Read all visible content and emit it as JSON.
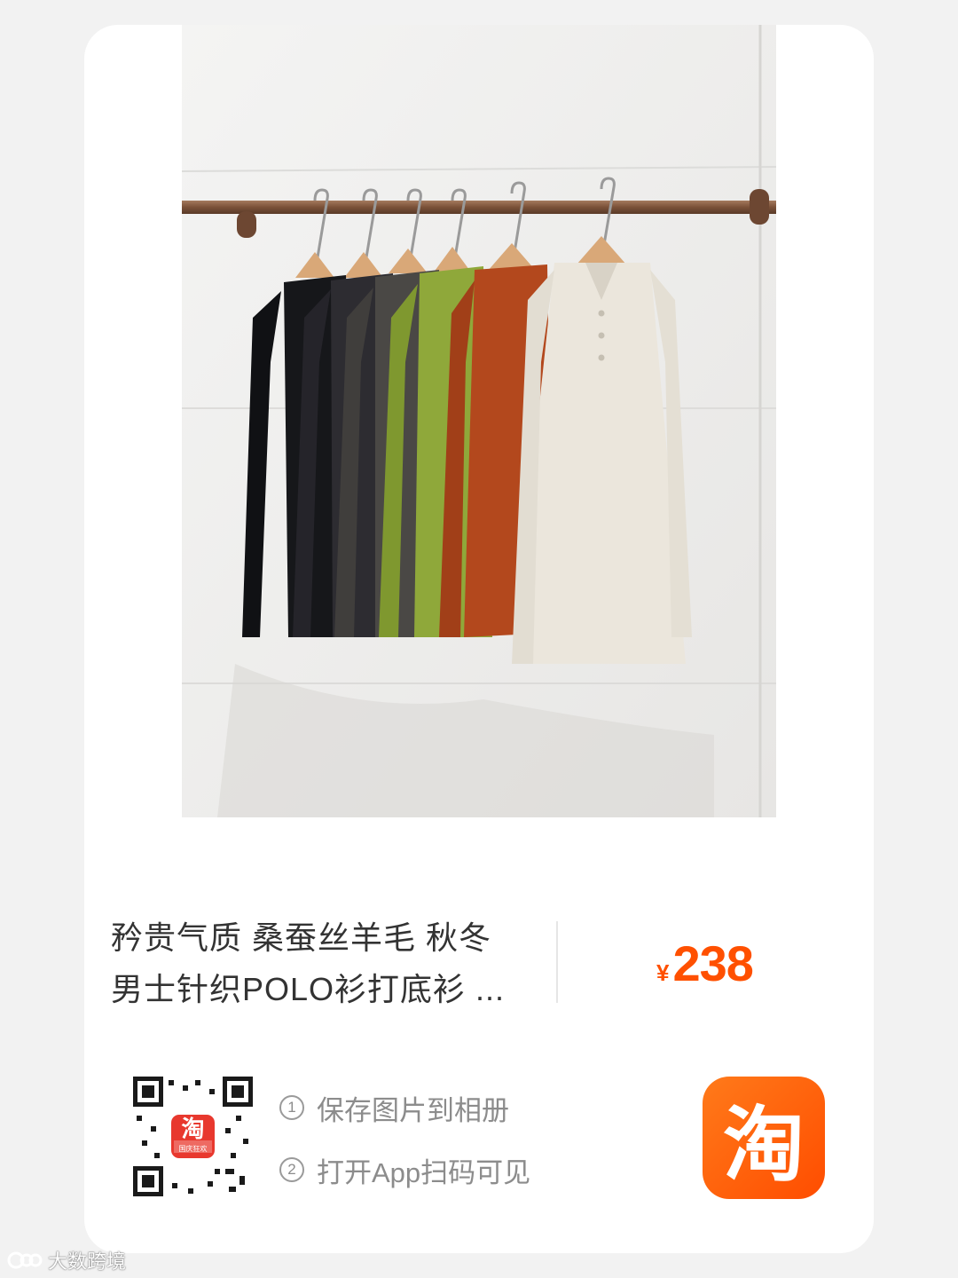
{
  "product": {
    "title_line1": "矜贵气质 桑蚕丝羊毛 秋冬",
    "title_line2": "男士针织POLO衫打底衫 ...",
    "price_currency": "¥",
    "price_value": "238"
  },
  "photo": {
    "sweater_colors": [
      "#16171a",
      "#2d2c31",
      "#4a4845",
      "#8fa83a",
      "#b3481d",
      "#ebe6dc"
    ]
  },
  "share": {
    "step1_index": "1",
    "step1_label": "保存图片到相册",
    "step2_index": "2",
    "step2_label": "打开App扫码可见",
    "qr_badge_char": "淘",
    "qr_badge_caption": "国庆狂欢",
    "app_icon_char": "淘"
  },
  "watermark": {
    "text": "大数跨境"
  },
  "colors": {
    "accent": "#ff5000",
    "app_icon": "#ff5a0e"
  }
}
